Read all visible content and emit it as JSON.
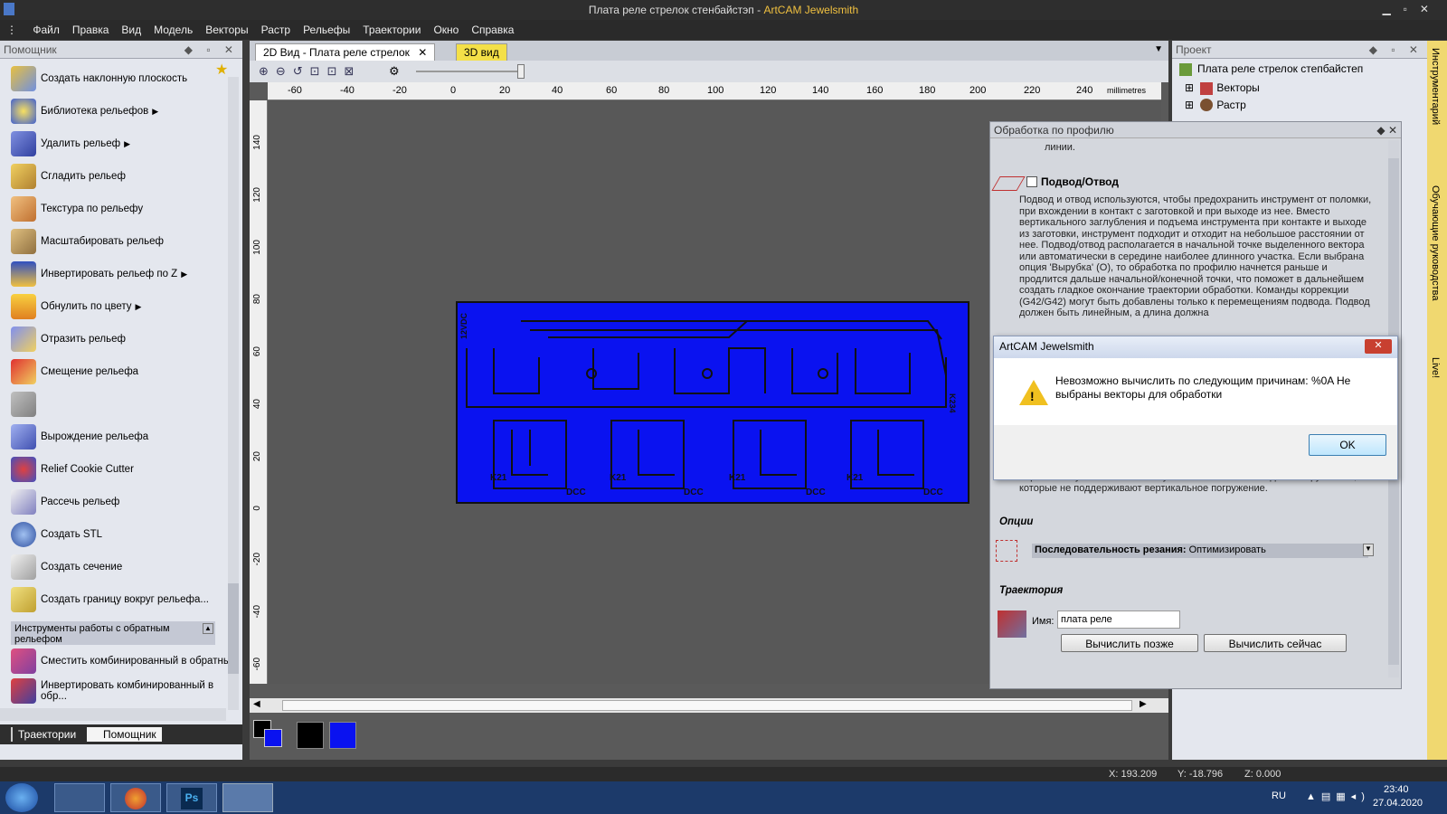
{
  "window": {
    "title_prefix": "Плата реле стрелок стенбайстэп - ",
    "title_app": "ArtCAM Jewelsmith"
  },
  "menu": [
    "Файл",
    "Правка",
    "Вид",
    "Модель",
    "Векторы",
    "Растр",
    "Рельефы",
    "Траектории",
    "Окно",
    "Справка"
  ],
  "left_panel": {
    "title": "Помощник",
    "tools": [
      "Создать наклонную плоскость",
      "Библиотека рельефов",
      "Удалить рельеф",
      "Сгладить рельеф",
      "Текстура по рельефу",
      "Масштабировать рельеф",
      "Инвертировать рельеф по Z",
      "Обнулить по цвету",
      "Отразить рельеф",
      "Смещение рельефа",
      "",
      "Вырождение рельефа",
      "Relief Cookie Cutter",
      "Рассечь рельеф",
      "Создать STL",
      "Создать сечение",
      "Создать границу вокруг рельефа..."
    ],
    "section_header": "Инструменты работы с обратным рельефом",
    "section_tools": [
      "Сместить комбинированный в обратный",
      "Инвертировать комбинированный в обр..."
    ],
    "bottom_tabs": [
      "Траектории",
      "Помощник"
    ]
  },
  "doc_tabs": {
    "tab1": "2D Вид - Плата реле стрелок",
    "tab2": "3D вид"
  },
  "ruler": {
    "h_labels": [
      "-60",
      "-40",
      "-20",
      "0",
      "20",
      "40",
      "60",
      "80",
      "100",
      "120",
      "140",
      "160",
      "180",
      "200",
      "220",
      "240"
    ],
    "unit": "millimetres",
    "v_labels": [
      "140",
      "120",
      "100",
      "80",
      "60",
      "40",
      "20",
      "0",
      "-20",
      "-40",
      "-60"
    ]
  },
  "board": {
    "label_left": "12VDC",
    "labels_k": [
      "K21",
      "K21",
      "K21",
      "K21"
    ],
    "labels_dcc": [
      "DCC",
      "DCC",
      "DCC",
      "DCC"
    ],
    "label_right": "K234"
  },
  "project": {
    "title": "Проект",
    "root": "Плата реле стрелок степбайстеп",
    "items": [
      "Векторы",
      "Растр"
    ]
  },
  "vtabs": [
    "Инструментарий",
    "Обучающие руководства",
    "Live!"
  ],
  "profile": {
    "title": "Обработка по профилю",
    "top_text": "линии.",
    "lead_title": "Подвод/Отвод",
    "lead_text": "Подвод и отвод используются, чтобы предохранить инструмент от поломки, при вхождении в контакт с заготовкой и при выходе из нее. Вместо вертикального заглубления и подъема инструмента при контакте и выходе из заготовки, инструмент подходит и отходит на небольшое расстоянии от нее. Подвод/отвод располагается в начальной точке выделенного вектора или автоматически в середине наиболее длинного участка. Если выбрана опция 'Вырубка' (O), то обработка по профилю начнется раньше и продлится дальше начальной/конечной точки, что поможет в дальнейшем создать гладкое окончание траектории обработки. Команды коррекции (G42/G42) могут быть добавлены только к перемещениям подвода. Подвод должен быть линейным, а длина должна",
    "after_text": "первом заглублении в заготовку. Это особенно важно для инструментов, которые не поддерживают вертикальное погружение.",
    "options_header": "Опции",
    "seq_label": "Последовательность резания:",
    "seq_value": "Оптимизировать",
    "toolpath_header": "Траектория",
    "name_label": "Имя:",
    "name_value": "плата реле",
    "btn_later": "Вычислить позже",
    "btn_now": "Вычислить сейчас"
  },
  "dialog": {
    "title": "ArtCAM Jewelsmith",
    "message": "Невозможно вычислить по следующим причинам: %0A   Не выбраны векторы для обработки",
    "ok": "OK"
  },
  "status": {
    "x": "X: 193.209",
    "y": "Y: -18.796",
    "z": "Z: 0.000"
  },
  "taskbar": {
    "lang": "RU",
    "time": "23:40",
    "date": "27.04.2020"
  },
  "colors": {
    "accent": "#f0c040",
    "board": "#0a12f0"
  }
}
